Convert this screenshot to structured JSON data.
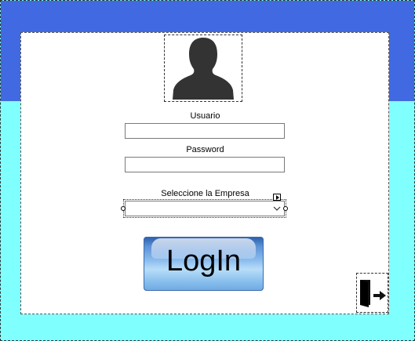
{
  "form": {
    "colors": {
      "top_band": "#4169E1",
      "background": "#80FFFF",
      "panel": "#FFFFFF"
    }
  },
  "avatar": {
    "icon": "user-silhouette-icon"
  },
  "usuario": {
    "label": "Usuario",
    "value": ""
  },
  "password": {
    "label": "Password",
    "value": ""
  },
  "empresa": {
    "label": "Seleccione la Empresa",
    "selected": "",
    "icon": "chevron-down-icon"
  },
  "login_button": {
    "label": "LogIn"
  },
  "exit_button": {
    "icon": "exit-door-icon"
  }
}
